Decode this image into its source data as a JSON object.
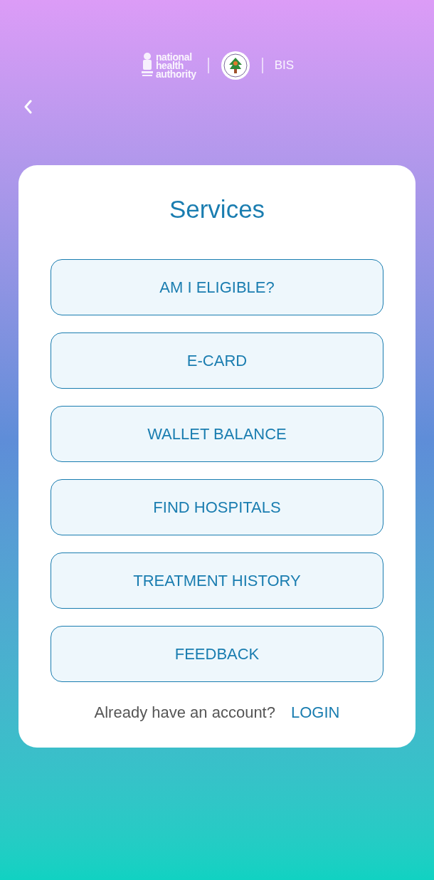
{
  "header": {
    "logo_text": [
      "national",
      "health",
      "authority"
    ],
    "label": "BIS"
  },
  "card": {
    "title": "Services",
    "buttons": [
      "AM I ELIGIBLE?",
      "E-CARD",
      "WALLET BALANCE",
      "FIND HOSPITALS",
      "TREATMENT HISTORY",
      "FEEDBACK"
    ],
    "footer": {
      "prompt": "Already have an account?",
      "link": "LOGIN"
    }
  }
}
